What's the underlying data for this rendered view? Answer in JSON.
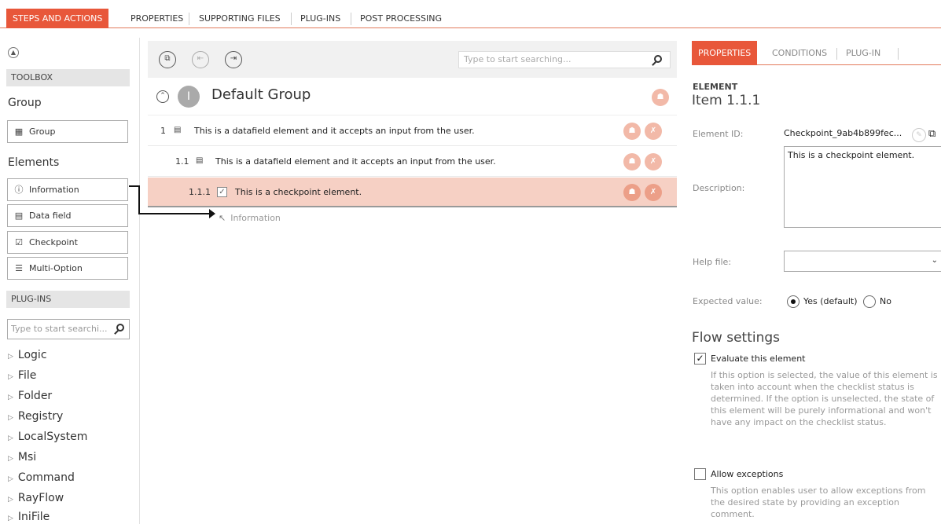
{
  "top_tabs": [
    "STEPS AND ACTIONS",
    "PROPERTIES",
    "SUPPORTING FILES",
    "PLUG-INS",
    "POST PROCESSING"
  ],
  "toolbox": {
    "header": "TOOLBOX",
    "group_section": "Group",
    "group_button": "Group",
    "elements_section": "Elements",
    "elements": [
      "Information",
      "Data field",
      "Checkpoint",
      "Multi-Option"
    ]
  },
  "plugins": {
    "header": "PLUG-INS",
    "search_placeholder": "Type to start searchi...",
    "items": [
      "Logic",
      "File",
      "Folder",
      "Registry",
      "LocalSystem",
      "Msi",
      "Command",
      "RayFlow",
      "IniFile"
    ]
  },
  "main": {
    "search_placeholder": "Type to start searching...",
    "group_badge": "I",
    "group_title": "Default Group",
    "rows": [
      {
        "num": "1",
        "text": "This is a datafield element and it accepts an input from the user."
      },
      {
        "num": "1.1",
        "text": "This is a datafield element and it accepts an input from the user."
      },
      {
        "num": "1.1.1",
        "text": "This is a checkpoint element."
      }
    ],
    "drop_hint": "Information"
  },
  "properties": {
    "tabs": [
      "PROPERTIES",
      "CONDITIONS",
      "PLUG-IN"
    ],
    "element_label": "ELEMENT",
    "item_title": "Item  1.1.1",
    "element_id_label": "Element ID:",
    "element_id_value": "Checkpoint_9ab4b899fec...",
    "description_label": "Description:",
    "description_value": "This is a checkpoint element.",
    "help_file_label": "Help file:",
    "help_file_value": "",
    "expected_value_label": "Expected value:",
    "expected_yes": "Yes (default)",
    "expected_no": "No",
    "flow_title": "Flow settings",
    "evaluate_label": "Evaluate this element",
    "evaluate_checked": true,
    "evaluate_desc": "If this option is selected, the value of this element is taken into account when the checklist status is determined. If the option is unselected, the state of this element will be purely informational and won't have any impact on the checklist status.",
    "allow_label": "Allow exceptions",
    "allow_checked": false,
    "allow_desc": "This option enables user to allow exceptions from the desired state by providing an exception comment."
  },
  "colors": {
    "accent": "#e8573a",
    "accent_light": "#f6d0c4",
    "icon_orange": "#f2b9a8"
  }
}
